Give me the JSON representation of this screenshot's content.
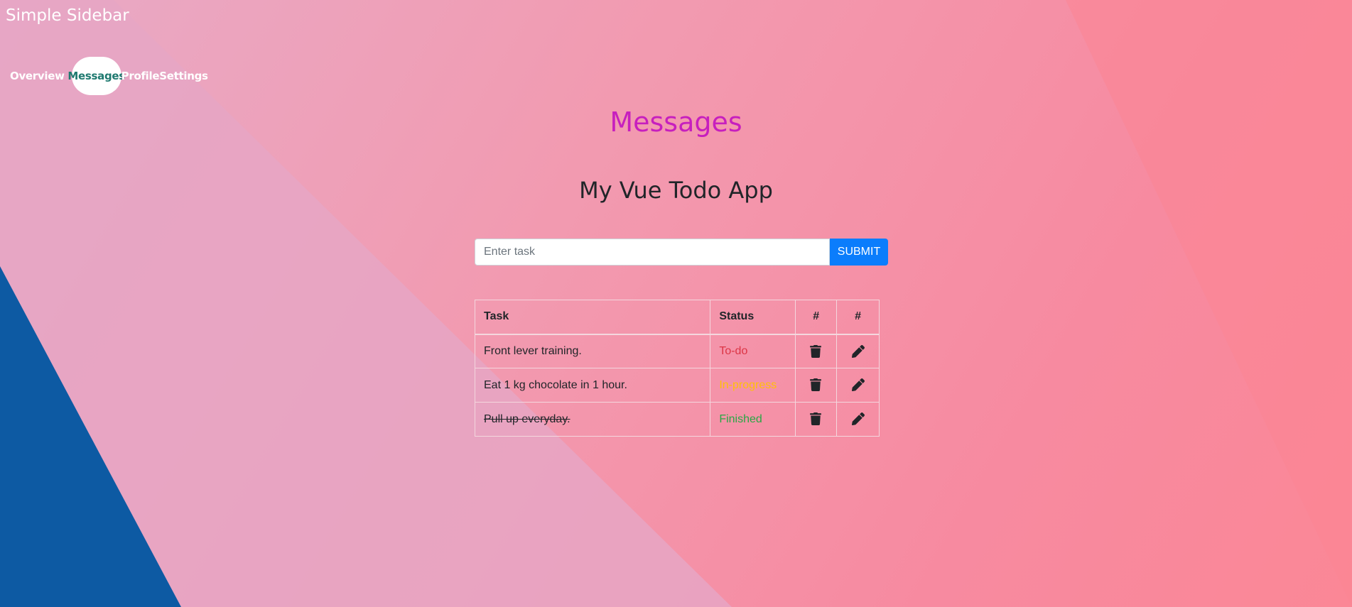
{
  "sidebar": {
    "title": "Simple Sidebar",
    "items": [
      {
        "label": "Overview"
      },
      {
        "label": "Messages"
      },
      {
        "label": "Profile"
      },
      {
        "label": "Settings"
      }
    ],
    "active_index": 1
  },
  "main": {
    "page_title": "Messages",
    "app_title": "My Vue Todo App",
    "input": {
      "placeholder": "Enter task",
      "value": ""
    },
    "submit_label": "SUBMIT",
    "table": {
      "headers": [
        "Task",
        "Status",
        "#",
        "#"
      ],
      "rows": [
        {
          "task": "Front lever training.",
          "status": "To-do",
          "done": false
        },
        {
          "task": "Eat 1 kg chocolate in 1 hour.",
          "status": "In-progress",
          "done": false
        },
        {
          "task": "Pull up everyday.",
          "status": "Finished",
          "done": true
        }
      ]
    }
  },
  "colors": {
    "page_title": "#c71fbe",
    "accent_blue": "#0b7dfc",
    "todo": "#dc3545",
    "in_progress": "#ffc107",
    "finished": "#28a745",
    "active_nav_text": "#1f7a70",
    "corner_blue": "#0d5aa3"
  },
  "icons": {
    "delete": "trash-icon",
    "edit": "pencil-icon"
  }
}
